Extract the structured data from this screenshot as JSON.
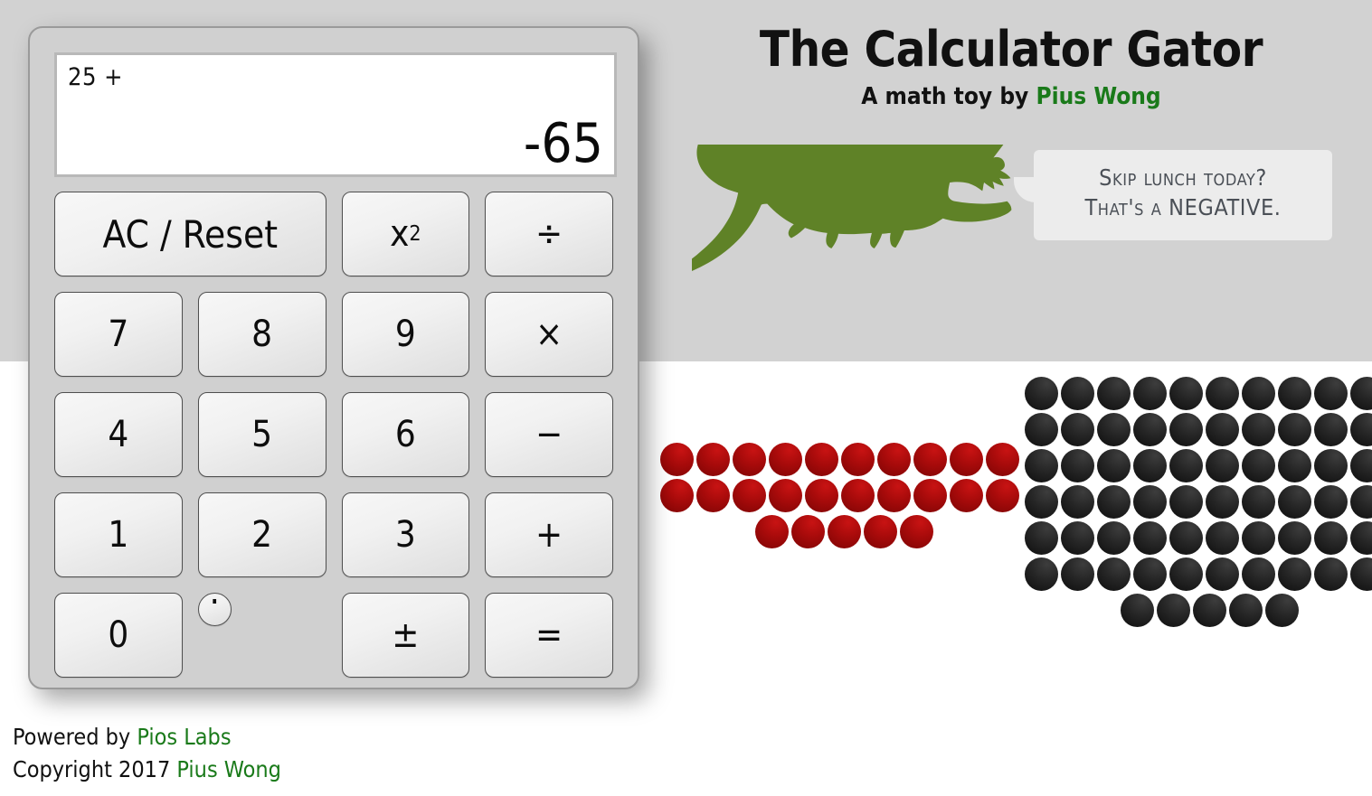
{
  "page": {
    "background_color": "#ffffff",
    "header_band_color": "#d2d2d2",
    "accent_green": "#1a7a1a",
    "gator_green": "#5f8227",
    "dot_red": "#a90b0b",
    "dot_black": "#262626"
  },
  "header": {
    "title": "The Calculator Gator",
    "subtitle_prefix": "A math toy by ",
    "author": "Pius Wong"
  },
  "calculator": {
    "display": {
      "expression": "25 +",
      "result": "-65"
    },
    "keys": [
      {
        "label": "AC / Reset",
        "name": "key-ac-reset",
        "span": 2
      },
      {
        "label": "x²",
        "name": "key-square",
        "span": 1,
        "superscript": true,
        "base": "x",
        "exp": "2"
      },
      {
        "label": "÷",
        "name": "key-divide",
        "span": 1
      },
      {
        "label": "7",
        "name": "key-7",
        "span": 1
      },
      {
        "label": "8",
        "name": "key-8",
        "span": 1
      },
      {
        "label": "9",
        "name": "key-9",
        "span": 1
      },
      {
        "label": "×",
        "name": "key-multiply",
        "span": 1
      },
      {
        "label": "4",
        "name": "key-4",
        "span": 1
      },
      {
        "label": "5",
        "name": "key-5",
        "span": 1
      },
      {
        "label": "6",
        "name": "key-6",
        "span": 1
      },
      {
        "label": "−",
        "name": "key-subtract",
        "span": 1
      },
      {
        "label": "1",
        "name": "key-1",
        "span": 1
      },
      {
        "label": "2",
        "name": "key-2",
        "span": 1
      },
      {
        "label": "3",
        "name": "key-3",
        "span": 1
      },
      {
        "label": "+",
        "name": "key-add",
        "span": 1
      },
      {
        "label": "0",
        "name": "key-0",
        "span": 1
      },
      {
        "label": ".",
        "name": "key-decimal",
        "span": 1
      },
      {
        "label": "±",
        "name": "key-plus-minus",
        "span": 1
      },
      {
        "label": "=",
        "name": "key-equals",
        "span": 1
      }
    ]
  },
  "gator": {
    "icon": "alligator-silhouette",
    "color": "#5f8227",
    "speech": {
      "line1": "Skip lunch today?",
      "line2": "That's a NEGATIVE."
    }
  },
  "visualization": {
    "red_group": {
      "label": "operand-dots",
      "total": 25,
      "color": "#a90b0b",
      "rows": [
        10,
        10,
        5
      ]
    },
    "black_group": {
      "label": "result-dots",
      "total": 65,
      "color": "#262626",
      "rows": [
        10,
        10,
        10,
        10,
        10,
        10,
        5
      ]
    }
  },
  "footer": {
    "powered_prefix": "Powered by ",
    "powered_link": "Pios Labs",
    "copyright_prefix": "Copyright 2017 ",
    "copyright_link": "Pius Wong"
  }
}
